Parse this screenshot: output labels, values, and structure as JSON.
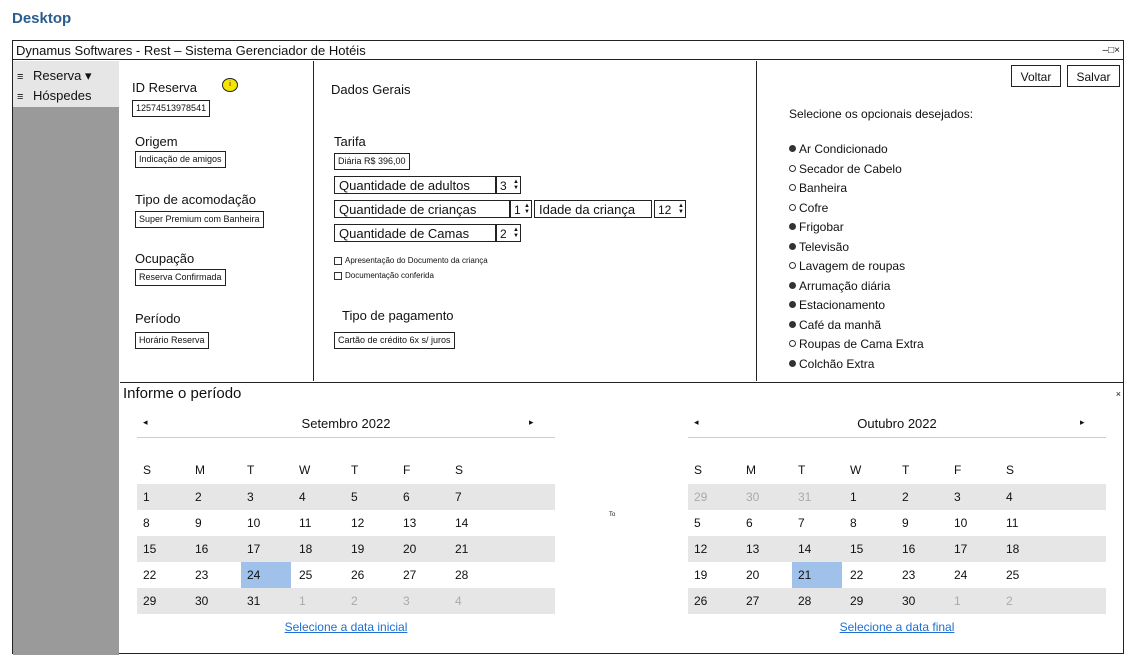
{
  "desktop_label": "Desktop",
  "window": {
    "title": "Dynamus Softwares - Rest – Sistema Gerenciador de Hotéis",
    "controls": "–□×"
  },
  "sidebar": {
    "items": [
      {
        "label": "Reserva ▾",
        "icon": "hamburger-icon"
      },
      {
        "label": "Hóspedes",
        "icon": "hamburger-icon"
      }
    ]
  },
  "form": {
    "id_reserva": {
      "label": "ID Reserva",
      "value": "12574513978541",
      "marker": "i"
    },
    "origem": {
      "label": "Origem",
      "value": "Indicação de amigos"
    },
    "tipo_acomodacao": {
      "label": "Tipo de acomodação",
      "value": "Super Premium com Banheira"
    },
    "ocupacao": {
      "label": "Ocupação",
      "value": "Reserva Confirmada"
    },
    "periodo": {
      "label": "Período",
      "value": "Horário Reserva"
    },
    "dados_gerais": "Dados Gerais",
    "tarifa": {
      "label": "Tarifa",
      "value": "Diária R$ 396,00"
    },
    "adultos": {
      "label": "Quantidade de adultos",
      "value": "3"
    },
    "criancas": {
      "label": "Quantidade de crianças",
      "value": "1"
    },
    "idade_crianca": {
      "label": "Idade da criança",
      "value": "12"
    },
    "camas": {
      "label": "Quantidade de Camas",
      "value": "2"
    },
    "checkboxes": [
      "Apresentação do Documento da criança",
      "Documentação conferida"
    ],
    "pagamento": {
      "label": "Tipo de pagamento",
      "value": "Cartão de crédito 6x s/ juros"
    }
  },
  "buttons": {
    "voltar": "Voltar",
    "salvar": "Salvar"
  },
  "opcionais": {
    "title": "Selecione os opcionais desejados:",
    "items": [
      {
        "label": "Ar Condicionado",
        "selected": true
      },
      {
        "label": "Secador de Cabelo",
        "selected": false
      },
      {
        "label": "Banheira",
        "selected": false
      },
      {
        "label": "Cofre",
        "selected": false
      },
      {
        "label": "Frigobar",
        "selected": true
      },
      {
        "label": "Televisão",
        "selected": true
      },
      {
        "label": "Lavagem de roupas",
        "selected": false
      },
      {
        "label": "Arrumação diária",
        "selected": true
      },
      {
        "label": "Estacionamento",
        "selected": true
      },
      {
        "label": "Café da manhã",
        "selected": true
      },
      {
        "label": "Roupas de Cama Extra",
        "selected": false
      },
      {
        "label": "Colchão Extra",
        "selected": true
      }
    ]
  },
  "calendar": {
    "title": "Informe o período",
    "close": "×",
    "to_label": "To",
    "weekdays": [
      "S",
      "M",
      "T",
      "W",
      "T",
      "F",
      "S"
    ],
    "left": {
      "month": "Setembro 2022",
      "prev": "◂",
      "next": "▸",
      "footer": "Selecione a data inicial",
      "weeks": [
        [
          {
            "d": "1"
          },
          {
            "d": "2"
          },
          {
            "d": "3"
          },
          {
            "d": "4"
          },
          {
            "d": "5"
          },
          {
            "d": "6"
          },
          {
            "d": "7"
          }
        ],
        [
          {
            "d": "8"
          },
          {
            "d": "9"
          },
          {
            "d": "10"
          },
          {
            "d": "11"
          },
          {
            "d": "12"
          },
          {
            "d": "13"
          },
          {
            "d": "14"
          }
        ],
        [
          {
            "d": "15"
          },
          {
            "d": "16"
          },
          {
            "d": "17"
          },
          {
            "d": "18"
          },
          {
            "d": "19"
          },
          {
            "d": "20"
          },
          {
            "d": "21"
          }
        ],
        [
          {
            "d": "22"
          },
          {
            "d": "23"
          },
          {
            "d": "24",
            "sel": true
          },
          {
            "d": "25"
          },
          {
            "d": "26"
          },
          {
            "d": "27"
          },
          {
            "d": "28"
          }
        ],
        [
          {
            "d": "29"
          },
          {
            "d": "30"
          },
          {
            "d": "31"
          },
          {
            "d": "1",
            "other": true
          },
          {
            "d": "2",
            "other": true
          },
          {
            "d": "3",
            "other": true
          },
          {
            "d": "4",
            "other": true
          }
        ]
      ]
    },
    "right": {
      "month": "Outubro 2022",
      "prev": "◂",
      "next": "▸",
      "footer": "Selecione a data final",
      "weeks": [
        [
          {
            "d": "29",
            "other": true
          },
          {
            "d": "30",
            "other": true
          },
          {
            "d": "31",
            "other": true
          },
          {
            "d": "1"
          },
          {
            "d": "2"
          },
          {
            "d": "3"
          },
          {
            "d": "4"
          }
        ],
        [
          {
            "d": "5"
          },
          {
            "d": "6"
          },
          {
            "d": "7"
          },
          {
            "d": "8"
          },
          {
            "d": "9"
          },
          {
            "d": "10"
          },
          {
            "d": "11"
          }
        ],
        [
          {
            "d": "12"
          },
          {
            "d": "13"
          },
          {
            "d": "14"
          },
          {
            "d": "15"
          },
          {
            "d": "16"
          },
          {
            "d": "17"
          },
          {
            "d": "18"
          }
        ],
        [
          {
            "d": "19"
          },
          {
            "d": "20"
          },
          {
            "d": "21",
            "sel": true
          },
          {
            "d": "22"
          },
          {
            "d": "23"
          },
          {
            "d": "24"
          },
          {
            "d": "25"
          }
        ],
        [
          {
            "d": "26"
          },
          {
            "d": "27"
          },
          {
            "d": "28"
          },
          {
            "d": "29"
          },
          {
            "d": "30"
          },
          {
            "d": "1",
            "other": true
          },
          {
            "d": "2",
            "other": true
          }
        ]
      ]
    }
  }
}
